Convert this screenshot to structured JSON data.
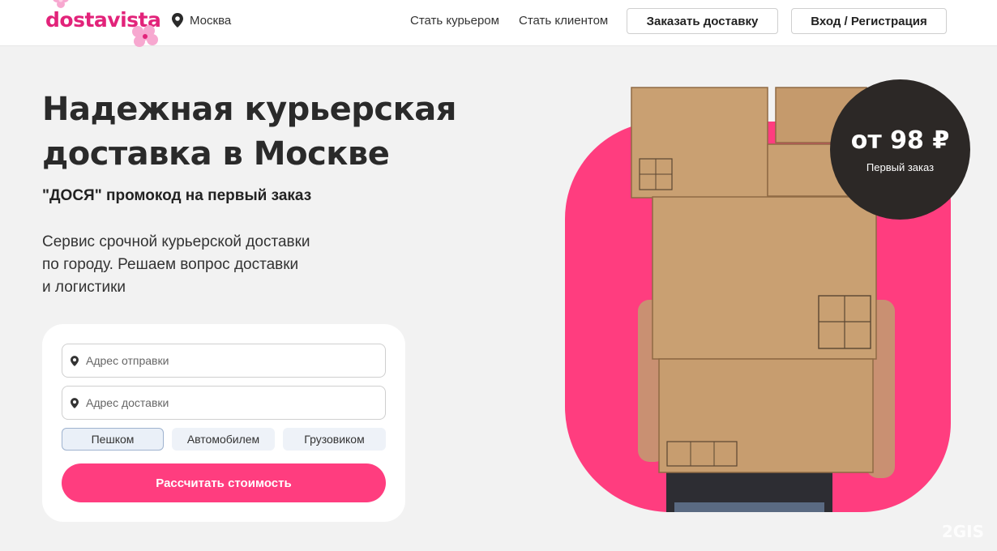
{
  "header": {
    "logo_text": "dostavista",
    "city": "Москва",
    "nav": {
      "become_courier": "Стать курьером",
      "become_client": "Стать клиентом"
    },
    "order_button": "Заказать доставку",
    "login_button": "Вход / Регистрация"
  },
  "hero": {
    "title_line1": "Надежная курьерская",
    "title_line2": "доставка в Москве",
    "promo": "\"ДОСЯ\" промокод на первый заказ",
    "desc_line1": "Сервис срочной курьерской доставки",
    "desc_line2": "по городу. Решаем вопрос доставки",
    "desc_line3": "и логистики"
  },
  "form": {
    "from_placeholder": "Адрес отправки",
    "to_placeholder": "Адрес доставки",
    "modes": [
      "Пешком",
      "Автомобилем",
      "Грузовиком"
    ],
    "selected_mode": "Пешком",
    "submit": "Рассчитать стоимость"
  },
  "badge": {
    "price": "от 98 ₽",
    "caption": "Первый заказ"
  },
  "watermark": "2GIS",
  "colors": {
    "brand_pink": "#ff3d7f",
    "logo_pink": "#e2237a",
    "badge_dark": "#2c2826",
    "background": "#f2f2f2"
  },
  "icons": {
    "location": "location-pin-icon",
    "flower": "flower-decoration-icon"
  }
}
